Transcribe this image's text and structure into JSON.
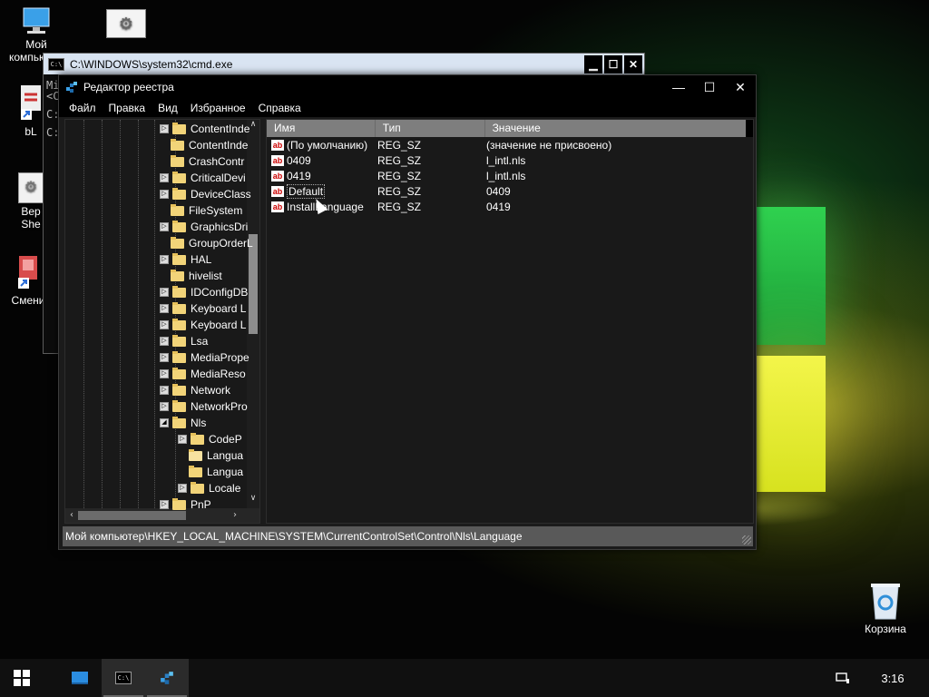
{
  "desktop": {
    "icons": [
      {
        "id": "my-computer",
        "label": "Мой\nкомпьютер"
      },
      {
        "id": "settings-shortcut",
        "label": ""
      },
      {
        "id": "bl-shortcut",
        "label": "bL"
      },
      {
        "id": "version-shell",
        "label": "Вер\nShe"
      },
      {
        "id": "change-shortcut",
        "label": "Смени"
      },
      {
        "id": "recycle-bin",
        "label": "Корзина"
      }
    ]
  },
  "cmd": {
    "title": "C:\\WINDOWS\\system32\\cmd.exe",
    "icon_text": "C:\\",
    "lines": [
      "Mi",
      "<C",
      "",
      "C:",
      "",
      "C:"
    ],
    "buttons": {
      "minimize": "▁",
      "maximize": "☐",
      "close": "✕"
    }
  },
  "regedit": {
    "title": "Редактор реестра",
    "menu": [
      "Файл",
      "Правка",
      "Вид",
      "Избранное",
      "Справка"
    ],
    "window_buttons": {
      "minimize": "—",
      "maximize": "☐",
      "close": "✕"
    },
    "tree": [
      {
        "label": "ContentInde",
        "expander": "▷",
        "indent": 0
      },
      {
        "label": "ContentInde",
        "expander": "",
        "indent": 0
      },
      {
        "label": "CrashContr",
        "expander": "",
        "indent": 0
      },
      {
        "label": "CriticalDevi",
        "expander": "▷",
        "indent": 0
      },
      {
        "label": "DeviceClass",
        "expander": "▷",
        "indent": 0
      },
      {
        "label": "FileSystem",
        "expander": "",
        "indent": 0
      },
      {
        "label": "GraphicsDri",
        "expander": "▷",
        "indent": 0
      },
      {
        "label": "GroupOrderL",
        "expander": "",
        "indent": 0
      },
      {
        "label": "HAL",
        "expander": "▷",
        "indent": 0
      },
      {
        "label": "hivelist",
        "expander": "",
        "indent": 0
      },
      {
        "label": "IDConfigDB",
        "expander": "▷",
        "indent": 0
      },
      {
        "label": "Keyboard L",
        "expander": "▷",
        "indent": 0
      },
      {
        "label": "Keyboard L",
        "expander": "▷",
        "indent": 0
      },
      {
        "label": "Lsa",
        "expander": "▷",
        "indent": 0
      },
      {
        "label": "MediaPrope",
        "expander": "▷",
        "indent": 0
      },
      {
        "label": "MediaReso",
        "expander": "▷",
        "indent": 0
      },
      {
        "label": "Network",
        "expander": "▷",
        "indent": 0
      },
      {
        "label": "NetworkPro",
        "expander": "▷",
        "indent": 0
      },
      {
        "label": "Nls",
        "expander": "◢",
        "indent": 0
      },
      {
        "label": "CodeP",
        "expander": "▷",
        "indent": 1
      },
      {
        "label": "Langua",
        "expander": "",
        "indent": 1,
        "open": true
      },
      {
        "label": "Langua",
        "expander": "",
        "indent": 1
      },
      {
        "label": "Locale",
        "expander": "▷",
        "indent": 1
      },
      {
        "label": "PnP",
        "expander": "▷",
        "indent": 0
      }
    ],
    "list": {
      "headers": [
        "Имя",
        "Тип",
        "Значение"
      ],
      "rows": [
        {
          "name": "(По умолчанию)",
          "type": "REG_SZ",
          "value": "(значение не присвоено)",
          "selected": false
        },
        {
          "name": "0409",
          "type": "REG_SZ",
          "value": "l_intl.nls",
          "selected": false
        },
        {
          "name": "0419",
          "type": "REG_SZ",
          "value": "l_intl.nls",
          "selected": false
        },
        {
          "name": "Default",
          "type": "REG_SZ",
          "value": "0409",
          "selected": true
        },
        {
          "name": "InstallLanguage",
          "type": "REG_SZ",
          "value": "0419",
          "selected": false
        }
      ],
      "icon_text": "ab"
    },
    "status": "Мой компьютер\\HKEY_LOCAL_MACHINE\\SYSTEM\\CurrentControlSet\\Control\\Nls\\Language"
  },
  "taskbar": {
    "clock": "3:16",
    "buttons": [
      "start-icon",
      "desktop-icon",
      "cmd-icon",
      "regedit-icon"
    ]
  }
}
